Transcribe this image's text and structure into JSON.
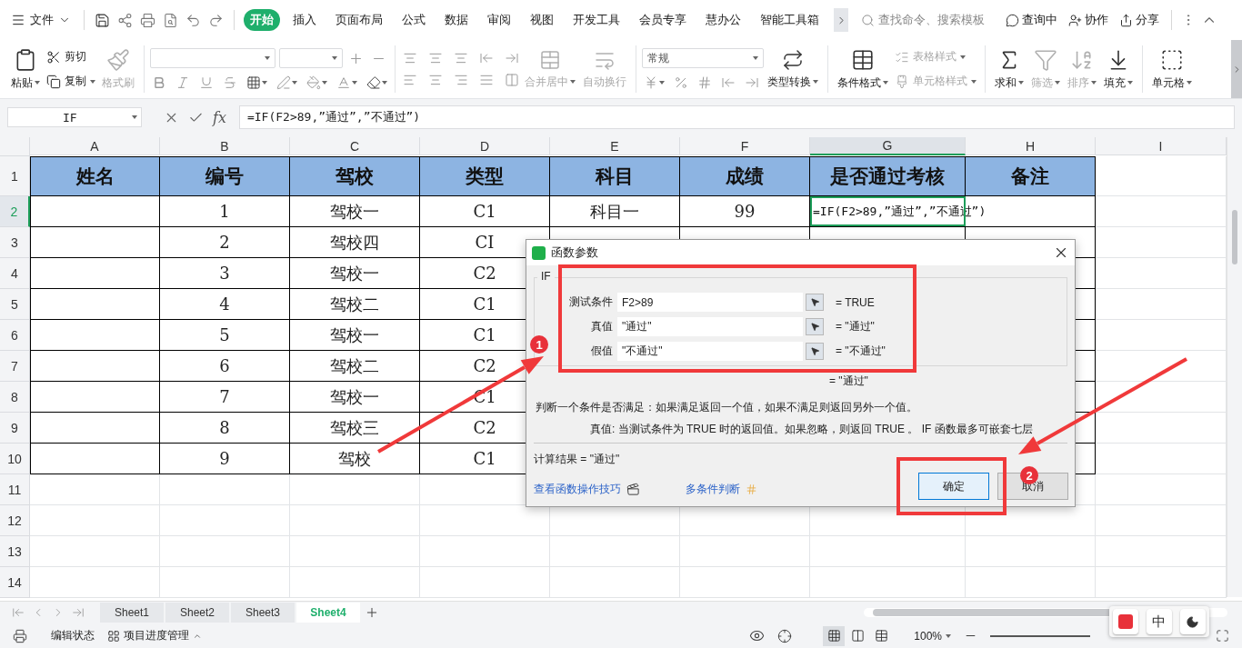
{
  "top_bar": {
    "file_menu": "文件",
    "tabs": [
      {
        "label": "开始",
        "selected": true
      },
      {
        "label": "插入",
        "selected": false
      },
      {
        "label": "页面布局",
        "selected": false
      },
      {
        "label": "公式",
        "selected": false
      },
      {
        "label": "数据",
        "selected": false
      },
      {
        "label": "审阅",
        "selected": false
      },
      {
        "label": "视图",
        "selected": false
      },
      {
        "label": "开发工具",
        "selected": false
      },
      {
        "label": "会员专享",
        "selected": false
      },
      {
        "label": "慧办公",
        "selected": false
      },
      {
        "label": "智能工具箱",
        "selected": false
      }
    ],
    "search": {
      "placeholder": "查找命令、搜索模板"
    },
    "actions": [
      "查询中",
      "协作",
      "分享"
    ]
  },
  "ribbon": {
    "paste": {
      "label": "粘贴",
      "disabled": false
    },
    "cut": {
      "label": "剪切",
      "disabled": false
    },
    "copy": {
      "label": "复制",
      "disabled": false
    },
    "format_painter": {
      "label": "格式刷",
      "disabled": true
    },
    "merge_center": {
      "label": "合并居中",
      "disabled": true
    },
    "wrap_text": {
      "label": "自动换行",
      "disabled": true
    },
    "number_format": {
      "value": "常规"
    },
    "type_convert": {
      "label": "类型转换",
      "disabled": false
    },
    "conditional_format": {
      "label": "条件格式",
      "disabled": false
    },
    "table_style": {
      "label": "表格样式",
      "disabled": true
    },
    "cell_style": {
      "label": "单元格样式",
      "disabled": true
    },
    "sum": {
      "label": "求和",
      "disabled": false
    },
    "filter": {
      "label": "筛选",
      "disabled": true
    },
    "sort": {
      "label": "排序",
      "disabled": true
    },
    "fill": {
      "label": "填充",
      "disabled": false
    },
    "cell": {
      "label": "单元格",
      "disabled": false
    }
  },
  "formula_bar": {
    "name_box": "IF",
    "fx": "fx",
    "formula": "=IF(F2>89,”通过”,”不通过”)"
  },
  "sheet": {
    "columns": [
      {
        "label": "A",
        "selected": false
      },
      {
        "label": "B",
        "selected": false
      },
      {
        "label": "C",
        "selected": false
      },
      {
        "label": "D",
        "selected": false
      },
      {
        "label": "E",
        "selected": false
      },
      {
        "label": "F",
        "selected": false
      },
      {
        "label": "G",
        "selected": true
      },
      {
        "label": "H",
        "selected": false
      },
      {
        "label": "I",
        "selected": false
      }
    ],
    "rows": [
      {
        "number": "1",
        "kind": "header",
        "selected": false,
        "a": "姓名",
        "b": "编号",
        "c": "驾校",
        "d": "类型",
        "e": "科目",
        "f": "成绩",
        "g": "是否通过考核",
        "h": "备注"
      },
      {
        "number": "2",
        "kind": "data",
        "selected": true,
        "b": "1",
        "c": "驾校一",
        "d": "C1",
        "e": "科目一",
        "f": "99",
        "g": "=IF(F2>89,”通过”,”不通过”)"
      },
      {
        "number": "3",
        "kind": "data",
        "selected": false,
        "b": "2",
        "c": "驾校四",
        "d": "CI"
      },
      {
        "number": "4",
        "kind": "data",
        "selected": false,
        "b": "3",
        "c": "驾校一",
        "d": "C2"
      },
      {
        "number": "5",
        "kind": "data",
        "selected": false,
        "b": "4",
        "c": "驾校二",
        "d": "C1"
      },
      {
        "number": "6",
        "kind": "data",
        "selected": false,
        "b": "5",
        "c": "驾校一",
        "d": "C1"
      },
      {
        "number": "7",
        "kind": "data",
        "selected": false,
        "b": "6",
        "c": "驾校二",
        "d": "C2"
      },
      {
        "number": "8",
        "kind": "data",
        "selected": false,
        "b": "7",
        "c": "驾校一",
        "d": "C1"
      },
      {
        "number": "9",
        "kind": "data",
        "selected": false,
        "b": "8",
        "c": "驾校三",
        "d": "C2"
      },
      {
        "number": "10",
        "kind": "data",
        "selected": false,
        "b": "9",
        "c": "驾校",
        "d": "C1"
      },
      {
        "number": "11",
        "kind": "empty",
        "selected": false
      },
      {
        "number": "12",
        "kind": "empty",
        "selected": false
      },
      {
        "number": "13",
        "kind": "empty",
        "selected": false
      },
      {
        "number": "14",
        "kind": "empty",
        "selected": false
      }
    ]
  },
  "dialog": {
    "title": "函数参数",
    "function": "IF",
    "params": [
      {
        "label": "测试条件",
        "value": "F2>89",
        "result": "= TRUE"
      },
      {
        "label": "真值",
        "value": "\"通过\"",
        "result": "= \"通过\""
      },
      {
        "label": "假值",
        "value": "\"不通过\"",
        "result": "= \"不通过\""
      }
    ],
    "function_result": "= \"通过\"",
    "description": "判断一个条件是否满足：如果满足返回一个值，如果不满足则返回另外一个值。",
    "param_help": "真值:  当测试条件为 TRUE 时的返回值。如果忽略，则返回 TRUE 。 IF 函数最多可嵌套七层",
    "calc_result": "计算结果 = \"通过\"",
    "links": [
      "查看函数操作技巧",
      "多条件判断"
    ],
    "buttons": [
      {
        "label": "确定",
        "default": true
      },
      {
        "label": "取消",
        "default": false
      }
    ]
  },
  "annotations": {
    "badges": [
      {
        "label": "1"
      },
      {
        "label": "2"
      }
    ]
  },
  "sheet_tabs": [
    {
      "label": "Sheet1",
      "selected": false
    },
    {
      "label": "Sheet2",
      "selected": false
    },
    {
      "label": "Sheet3",
      "selected": false
    },
    {
      "label": "Sheet4",
      "selected": true
    }
  ],
  "status_bar": {
    "items": [
      "编辑状态",
      "项目进度管理"
    ],
    "view_modes": [
      {
        "selected": true
      },
      {
        "selected": false
      },
      {
        "selected": false
      }
    ],
    "zoom": "100%"
  },
  "ime_bar": {
    "label": "中"
  }
}
